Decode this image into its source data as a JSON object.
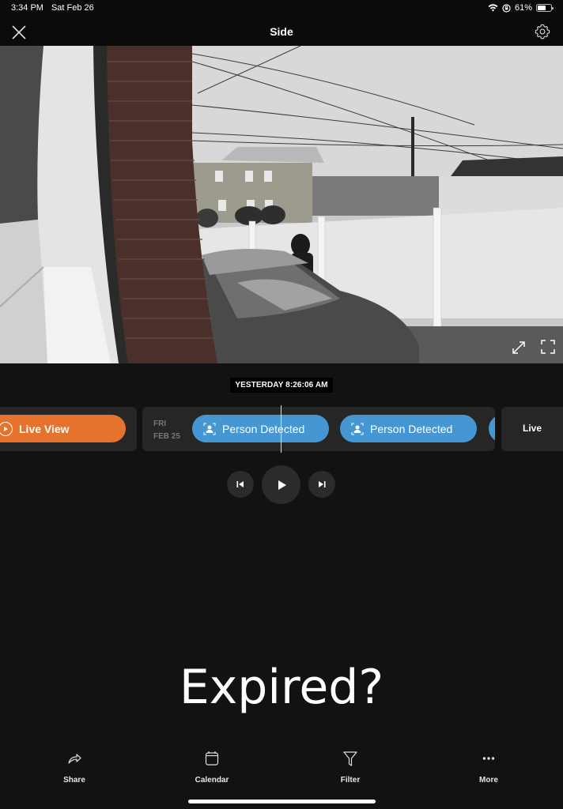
{
  "status_bar": {
    "time": "3:34 PM",
    "date": "Sat Feb 26",
    "battery_percent_label": "61%",
    "battery_level": 0.61
  },
  "nav": {
    "title": "Side",
    "close_icon": "close-icon",
    "settings_icon": "gear-icon"
  },
  "camera": {
    "controls": [
      "expand-icon",
      "fullscreen-icon"
    ]
  },
  "timestamp": "YESTERDAY 8:26:06 AM",
  "timeline": {
    "live_view_label": "Live View",
    "day_label": "FRI",
    "date_label": "FEB 25",
    "events": [
      {
        "label": "Person Detected",
        "icon": "person-icon"
      },
      {
        "label": "Person Detected",
        "icon": "person-icon"
      }
    ],
    "live_label": "Live"
  },
  "playback": {
    "previous_icon": "skip-previous-icon",
    "play_icon": "play-icon",
    "next_icon": "skip-next-icon"
  },
  "overlay_text": "Expired?",
  "bottom_tabs": [
    {
      "label": "Share",
      "icon": "share-icon"
    },
    {
      "label": "Calendar",
      "icon": "calendar-icon"
    },
    {
      "label": "Filter",
      "icon": "filter-icon"
    },
    {
      "label": "More",
      "icon": "more-icon"
    }
  ],
  "colors": {
    "live_view": "#e5732e",
    "event": "#4597d3",
    "background": "#121212"
  }
}
